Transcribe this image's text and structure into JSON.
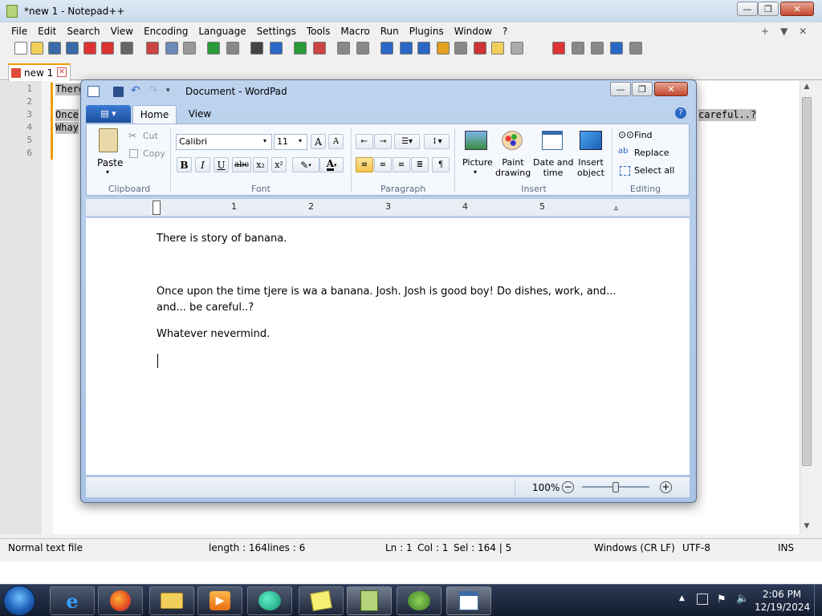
{
  "notepad": {
    "title": "*new 1 - Notepad++",
    "menu": [
      "File",
      "Edit",
      "Search",
      "View",
      "Encoding",
      "Language",
      "Settings",
      "Tools",
      "Macro",
      "Run",
      "Plugins",
      "Window",
      "?"
    ],
    "menu_right": [
      "+",
      "▼",
      "✕"
    ],
    "tab_label": "new 1",
    "line_numbers": [
      "1",
      "2",
      "3",
      "4",
      "5",
      "6"
    ],
    "visible_lines": [
      "There",
      "",
      "Once",
      "Whay"
    ],
    "line3_tail": "careful..?",
    "status": {
      "type": "Normal text file",
      "length": "length : 164",
      "lines": "lines : 6",
      "ln": "Ln : 1",
      "col": "Col : 1",
      "sel": "Sel : 164 | 5",
      "eol": "Windows (CR LF)",
      "encoding": "UTF-8",
      "mode": "INS"
    }
  },
  "wordpad": {
    "title": "Document - WordPad",
    "tabs": [
      "Home",
      "View"
    ],
    "clipboard": {
      "paste": "Paste",
      "cut": "Cut",
      "copy": "Copy",
      "label": "Clipboard"
    },
    "font": {
      "name": "Calibri",
      "size": "11",
      "label": "Font",
      "bold": "B",
      "italic": "I",
      "underline": "U",
      "strike": "abc",
      "sub": "x₂",
      "sup": "x²"
    },
    "paragraph": {
      "label": "Paragraph"
    },
    "insert": {
      "picture": "Picture",
      "paint": "Paint\ndrawing",
      "datetime": "Date and\ntime",
      "object": "Insert\nobject",
      "label": "Insert"
    },
    "editing": {
      "find": "Find",
      "replace": "Replace",
      "select_all": "Select all",
      "label": "Editing"
    },
    "ruler": [
      "1",
      "2",
      "3",
      "4",
      "5"
    ],
    "doc": [
      "There is story of banana.",
      "Once upon the time  tjere is wa a banana. Josh. Josh is good boy! Do dishes, work, and...",
      "and... be careful..?",
      "Whatever nevermind."
    ],
    "zoom": "100%",
    "zoom_level": 0.5
  },
  "taskbar": {
    "time": "2:06 PM",
    "date": "12/19/2024"
  },
  "colors": {
    "notepad_bg": "#ffffff",
    "ribbon_bg": "#f5f8fc",
    "accent_blue": "#2b67c5",
    "taskbar": "#18223a"
  }
}
